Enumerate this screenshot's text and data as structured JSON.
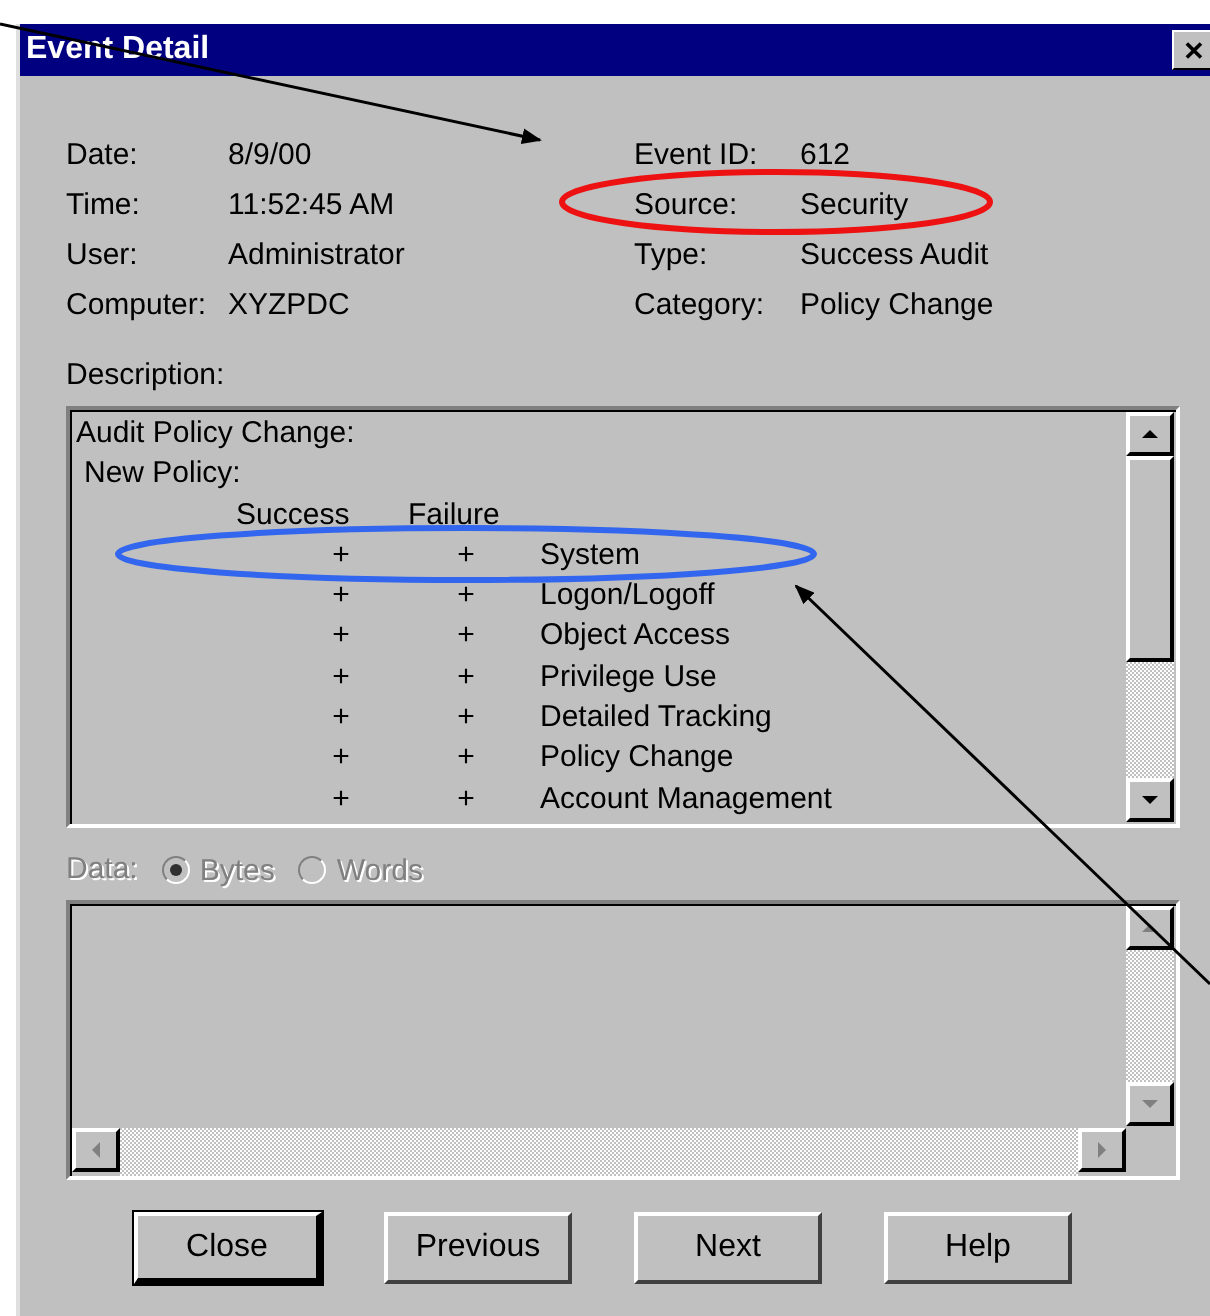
{
  "window": {
    "title": "Event Detail",
    "close_glyph": "✕"
  },
  "fields_left": [
    {
      "label": "Date:",
      "value": "8/9/00"
    },
    {
      "label": "Time:",
      "value": "11:52:45 AM"
    },
    {
      "label": "User:",
      "value": "Administrator"
    },
    {
      "label": "Computer:",
      "value": "XYZPDC"
    }
  ],
  "fields_right": [
    {
      "label": "Event ID:",
      "value": "612"
    },
    {
      "label": "Source:",
      "value": "Security"
    },
    {
      "label": "Type:",
      "value": "Success Audit"
    },
    {
      "label": "Category:",
      "value": "Policy Change"
    }
  ],
  "description": {
    "label": "Description:",
    "title": "Audit Policy Change:",
    "subtitle": "New Policy:",
    "columns": [
      "Success",
      "Failure"
    ],
    "rows": [
      {
        "success": "+",
        "failure": "+",
        "name": "System"
      },
      {
        "success": "+",
        "failure": "+",
        "name": "Logon/Logoff"
      },
      {
        "success": "+",
        "failure": "+",
        "name": "Object Access"
      },
      {
        "success": "+",
        "failure": "+",
        "name": "Privilege Use"
      },
      {
        "success": "+",
        "failure": "+",
        "name": "Detailed Tracking"
      },
      {
        "success": "+",
        "failure": "+",
        "name": "Policy Change"
      },
      {
        "success": "+",
        "failure": "+",
        "name": "Account Management"
      }
    ]
  },
  "data": {
    "label": "Data:",
    "disabled": true,
    "options": [
      {
        "label": "Bytes",
        "selected": true
      },
      {
        "label": "Words",
        "selected": false
      }
    ]
  },
  "buttons": [
    {
      "label": "Close",
      "default": true
    },
    {
      "label": "Previous",
      "default": false
    },
    {
      "label": "Next",
      "default": false
    },
    {
      "label": "Help",
      "default": false
    }
  ]
}
